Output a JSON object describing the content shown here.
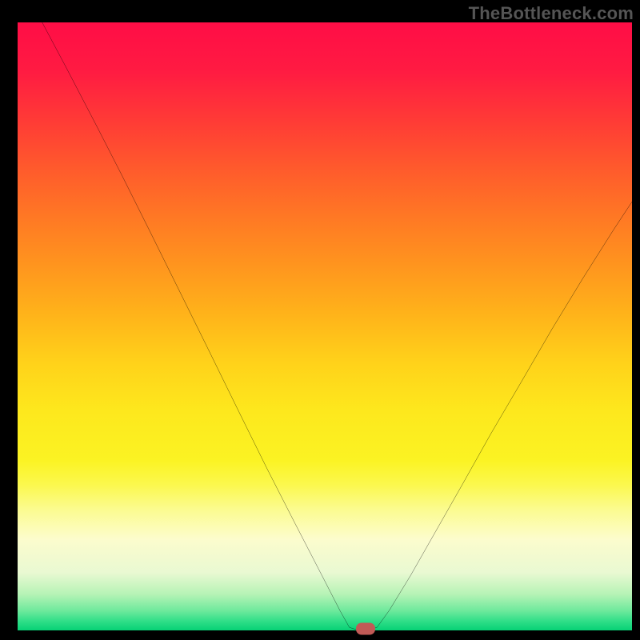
{
  "watermark": "TheBottleneck.com",
  "gradient": {
    "stops": [
      {
        "offset": 0.0,
        "color": "#ff0d46"
      },
      {
        "offset": 0.08,
        "color": "#ff1b42"
      },
      {
        "offset": 0.16,
        "color": "#ff3a36"
      },
      {
        "offset": 0.24,
        "color": "#ff5a2c"
      },
      {
        "offset": 0.32,
        "color": "#ff7824"
      },
      {
        "offset": 0.4,
        "color": "#ff951e"
      },
      {
        "offset": 0.48,
        "color": "#ffb31a"
      },
      {
        "offset": 0.56,
        "color": "#ffd21a"
      },
      {
        "offset": 0.64,
        "color": "#fde81d"
      },
      {
        "offset": 0.72,
        "color": "#fbf323"
      },
      {
        "offset": 0.76,
        "color": "#fbf84d"
      },
      {
        "offset": 0.8,
        "color": "#fbfb8e"
      },
      {
        "offset": 0.85,
        "color": "#fcfccd"
      },
      {
        "offset": 0.905,
        "color": "#e9f9d2"
      },
      {
        "offset": 0.94,
        "color": "#b7f3b6"
      },
      {
        "offset": 0.968,
        "color": "#6de99c"
      },
      {
        "offset": 0.985,
        "color": "#2fde88"
      },
      {
        "offset": 1.0,
        "color": "#06d175"
      }
    ]
  },
  "chart_type": "line",
  "marker": {
    "x_frac": 0.567,
    "y_frac": 0.998,
    "color": "#c15a56"
  },
  "chart_data": {
    "type": "line",
    "title": "",
    "xlabel": "",
    "ylabel": "",
    "xlim": [
      0,
      100
    ],
    "ylim": [
      0,
      100
    ],
    "series": [
      {
        "name": "bottleneck-curve",
        "points": [
          {
            "x": 4.0,
            "y": 100.0
          },
          {
            "x": 8.0,
            "y": 92.4
          },
          {
            "x": 13.0,
            "y": 82.7
          },
          {
            "x": 17.0,
            "y": 74.8
          },
          {
            "x": 21.5,
            "y": 65.7
          },
          {
            "x": 26.5,
            "y": 55.5
          },
          {
            "x": 31.0,
            "y": 46.3
          },
          {
            "x": 36.0,
            "y": 36.0
          },
          {
            "x": 40.5,
            "y": 26.8
          },
          {
            "x": 45.0,
            "y": 17.9
          },
          {
            "x": 49.5,
            "y": 9.1
          },
          {
            "x": 52.5,
            "y": 3.2
          },
          {
            "x": 54.0,
            "y": 0.5
          },
          {
            "x": 55.5,
            "y": 0.0
          },
          {
            "x": 57.0,
            "y": 0.0
          },
          {
            "x": 58.5,
            "y": 0.5
          },
          {
            "x": 60.5,
            "y": 3.3
          },
          {
            "x": 64.0,
            "y": 9.1
          },
          {
            "x": 68.0,
            "y": 16.2
          },
          {
            "x": 72.5,
            "y": 24.2
          },
          {
            "x": 77.0,
            "y": 32.3
          },
          {
            "x": 82.0,
            "y": 40.9
          },
          {
            "x": 87.0,
            "y": 49.6
          },
          {
            "x": 92.0,
            "y": 57.9
          },
          {
            "x": 97.0,
            "y": 65.9
          },
          {
            "x": 100.0,
            "y": 70.5
          }
        ]
      }
    ],
    "marker": {
      "x": 56.7,
      "y": 0.2
    }
  }
}
